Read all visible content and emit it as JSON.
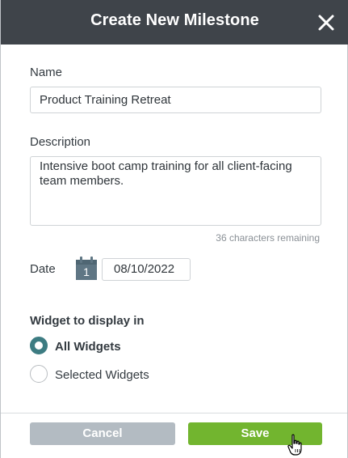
{
  "header": {
    "title": "Create New Milestone"
  },
  "form": {
    "name_label": "Name",
    "name_value": "Product Training Retreat",
    "description_label": "Description",
    "description_value": "Intensive boot camp training for all client-facing team members.",
    "chars_remaining": "36 characters remaining",
    "date_label": "Date",
    "calendar_day": "1",
    "date_value": "08/10/2022",
    "widget_section_title": "Widget to display in",
    "widget_options": [
      {
        "label": "All Widgets",
        "checked": true
      },
      {
        "label": "Selected Widgets",
        "checked": false
      }
    ]
  },
  "footer": {
    "cancel_label": "Cancel",
    "save_label": "Save"
  },
  "colors": {
    "header_bg": "#3f444a",
    "radio_checked": "#3d7c82",
    "save_button": "#72b52f",
    "cancel_button": "#b3bbc2",
    "calendar_icon": "#5f7684"
  },
  "icons": {
    "close": "close-icon",
    "calendar": "calendar-icon",
    "cursor": "hand-pointer-icon"
  }
}
